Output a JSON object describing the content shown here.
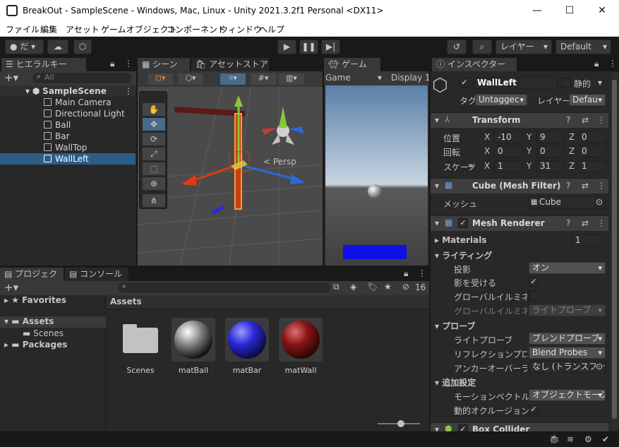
{
  "window": {
    "title": "BreakOut - SampleScene - Windows, Mac, Linux - Unity 2021.3.2f1 Personal <DX11>"
  },
  "menu": [
    "ファイル",
    "編集",
    "アセット",
    "ゲームオブジェクト",
    "コンポーネント",
    "ウィンドウ",
    "ヘルプ"
  ],
  "toolbar": {
    "account": "だ",
    "layers": "レイヤー",
    "layout": "Default"
  },
  "hierarchy": {
    "tab": "ヒエラルキー",
    "search_placeholder": "All",
    "scene": "SampleScene",
    "items": [
      "Main Camera",
      "Directional Light",
      "Ball",
      "Bar",
      "WallTop",
      "WallLeft"
    ],
    "selected": "WallLeft"
  },
  "scene_view": {
    "tab_scene": "シーン",
    "tab_store": "アセットストア",
    "persp": "< Persp"
  },
  "game_view": {
    "tab": "ゲーム",
    "display_dropdown": "Game",
    "display": "Display 1"
  },
  "project": {
    "tab_project": "プロジェクト",
    "tab_console": "コンソール",
    "hidden_count": "16",
    "tree": {
      "favorites": "Favorites",
      "assets": "Assets",
      "scenes": "Scenes",
      "packages": "Packages"
    },
    "breadcrumb": "Assets",
    "assets": [
      {
        "name": "Scenes",
        "kind": "folder"
      },
      {
        "name": "matBall",
        "kind": "material",
        "color": "#b0b0b0"
      },
      {
        "name": "matBar",
        "kind": "material",
        "color": "#2a2ad8"
      },
      {
        "name": "matWall",
        "kind": "material",
        "color": "#a01818"
      }
    ]
  },
  "inspector": {
    "tab": "インスペクター",
    "object_name": "WallLeft",
    "static_label": "静的",
    "tag_label": "タグ",
    "tag_value": "Untaggec",
    "layer_label": "レイヤー",
    "layer_value": "Defau",
    "transform": {
      "title": "Transform",
      "position_label": "位置",
      "position": {
        "x": "-10",
        "y": "9",
        "z": "0"
      },
      "rotation_label": "回転",
      "rotation": {
        "x": "0",
        "y": "0",
        "z": "0"
      },
      "scale_label": "スケーノ",
      "scale": {
        "x": "1",
        "y": "31",
        "z": "1"
      }
    },
    "mesh_filter": {
      "title": "Cube (Mesh Filter)",
      "mesh_label": "メッシュ",
      "mesh_value": "Cube"
    },
    "mesh_renderer": {
      "title": "Mesh Renderer",
      "materials_label": "Materials",
      "materials_count": "1",
      "lighting_label": "ライティング",
      "cast_shadows_label": "投影",
      "cast_shadows_value": "オン",
      "receive_shadows_label": "影を受ける",
      "gi_label": "グローバルイルミネーシ",
      "gi2_label": "グローバルイルミネーシ",
      "gi2_value": "ライトプローブ",
      "probes_label": "プローブ",
      "light_probes_label": "ライトプローブ",
      "light_probes_value": "ブレンドプローブ",
      "reflection_label": "リフレクションプローブ",
      "reflection_value": "Blend Probes",
      "anchor_label": "アンカーオーバーライド",
      "anchor_value": "なし (トランスフォー",
      "additional_label": "追加設定",
      "motion_label": "モーションベクトル",
      "motion_value": "オブジェクトモーショ",
      "occlusion_label": "動的オクルージョン"
    },
    "box_collider": {
      "title": "Box Collider"
    }
  },
  "axes": {
    "x": "X",
    "y": "Y",
    "z": "Z"
  }
}
